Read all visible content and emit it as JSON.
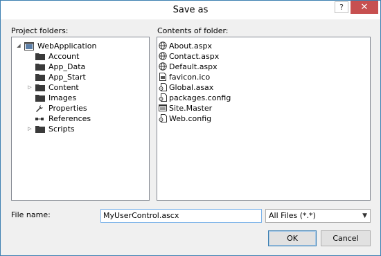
{
  "dialog": {
    "title": "Save as",
    "help_label": "?",
    "close_label": "✕"
  },
  "project_folders": {
    "label": "Project folders:",
    "items": [
      {
        "label": "WebApplication",
        "level": 0,
        "expanded": true,
        "icon": "project-icon"
      },
      {
        "label": "Account",
        "level": 1,
        "expandable": false,
        "icon": "folder-icon"
      },
      {
        "label": "App_Data",
        "level": 1,
        "expandable": false,
        "icon": "folder-icon"
      },
      {
        "label": "App_Start",
        "level": 1,
        "expandable": false,
        "icon": "folder-icon"
      },
      {
        "label": "Content",
        "level": 1,
        "expandable": true,
        "icon": "folder-icon"
      },
      {
        "label": "Images",
        "level": 1,
        "expandable": false,
        "icon": "folder-icon"
      },
      {
        "label": "Properties",
        "level": 1,
        "expandable": false,
        "icon": "wrench-icon"
      },
      {
        "label": "References",
        "level": 1,
        "expandable": false,
        "icon": "references-icon"
      },
      {
        "label": "Scripts",
        "level": 1,
        "expandable": true,
        "icon": "folder-icon"
      }
    ]
  },
  "contents": {
    "label": "Contents of folder:",
    "items": [
      {
        "label": "About.aspx",
        "icon": "web-page-icon"
      },
      {
        "label": "Contact.aspx",
        "icon": "web-page-icon"
      },
      {
        "label": "Default.aspx",
        "icon": "web-page-icon"
      },
      {
        "label": "favicon.ico",
        "icon": "image-file-icon"
      },
      {
        "label": "Global.asax",
        "icon": "config-file-icon"
      },
      {
        "label": "packages.config",
        "icon": "config-file-icon"
      },
      {
        "label": "Site.Master",
        "icon": "master-page-icon"
      },
      {
        "label": "Web.config",
        "icon": "config-file-icon"
      }
    ]
  },
  "file_name": {
    "label": "File name:",
    "value": "MyUserControl.ascx"
  },
  "file_type": {
    "selected": "All Files (*.*)"
  },
  "buttons": {
    "ok": "OK",
    "cancel": "Cancel"
  }
}
